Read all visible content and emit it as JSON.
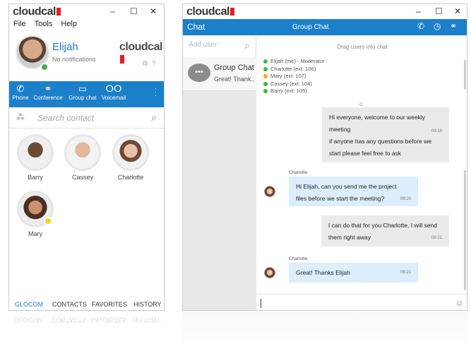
{
  "left": {
    "title_logo": {
      "part1": "cloud",
      "part2": "cal"
    },
    "window_controls": [
      "–",
      "☐",
      "✕"
    ],
    "menu": [
      "File",
      "Tools",
      "Help"
    ],
    "profile": {
      "name": "Elijah",
      "status": "No notifications",
      "brand": "cloudcal"
    },
    "nav": [
      {
        "label": "Phone",
        "icon": "phone-icon"
      },
      {
        "label": "Conference",
        "icon": "conference-icon"
      },
      {
        "label": "Group chat",
        "icon": "group-chat-icon"
      },
      {
        "label": "Voicemail",
        "icon": "voicemail-icon"
      }
    ],
    "search": {
      "placeholder": "Search contact"
    },
    "contacts": [
      {
        "name": "Barry"
      },
      {
        "name": "Cassey"
      },
      {
        "name": "Charlotte"
      },
      {
        "name": "Mary"
      }
    ],
    "tabs": [
      "GLOCOM",
      "CONTACTS",
      "FAVORITES",
      "HISTORY"
    ],
    "active_tab": "GLOCOM",
    "colors": {
      "accent": "#1c7fc9",
      "online": "#3bb44a",
      "away": "#f7d217",
      "brand_red": "#e31e24"
    }
  },
  "right": {
    "title_logo": {
      "part1": "cloud",
      "part2": "cal"
    },
    "window_controls": [
      "–",
      "☐",
      "✕"
    ],
    "header": {
      "title": "Chat",
      "subtitle": "Group Chat"
    },
    "sidebar": {
      "add_placeholder": "Add user",
      "item": {
        "title": "Group Chat",
        "snippet": "Great! Thank..."
      }
    },
    "drag_hint": "Drag users into chat",
    "members": [
      {
        "text": "Elijah (me) - Moderator",
        "color": "#3bb44a"
      },
      {
        "text": "Charlotte (ext: 106)",
        "color": "#3bb44a"
      },
      {
        "text": "Mary (ext: 107)",
        "color": "#f7a823"
      },
      {
        "text": "Cassey (ext: 104)",
        "color": "#3bb44a"
      },
      {
        "text": "Barry (ext: 105)",
        "color": "#3bb44a"
      }
    ],
    "system_marker": "o",
    "messages": [
      {
        "line1": "Hi everyone, welcome to our weekly",
        "line2": "meeting",
        "line3": "if anyone has any questions before we",
        "line4": "start please feel free to ask",
        "time": "09:19"
      },
      {
        "sender": "Charlotte",
        "line1": "Hi Elijah, can you send me the project",
        "line2": "files before we start the meeting?",
        "time": "09:20"
      },
      {
        "line1": "I can do that for you Charlotte, I will send",
        "line2": "them right away",
        "time": "09:21"
      },
      {
        "sender": "Charlotte",
        "line1": "Great! Thanks Elijah",
        "time": "09:21"
      }
    ]
  }
}
